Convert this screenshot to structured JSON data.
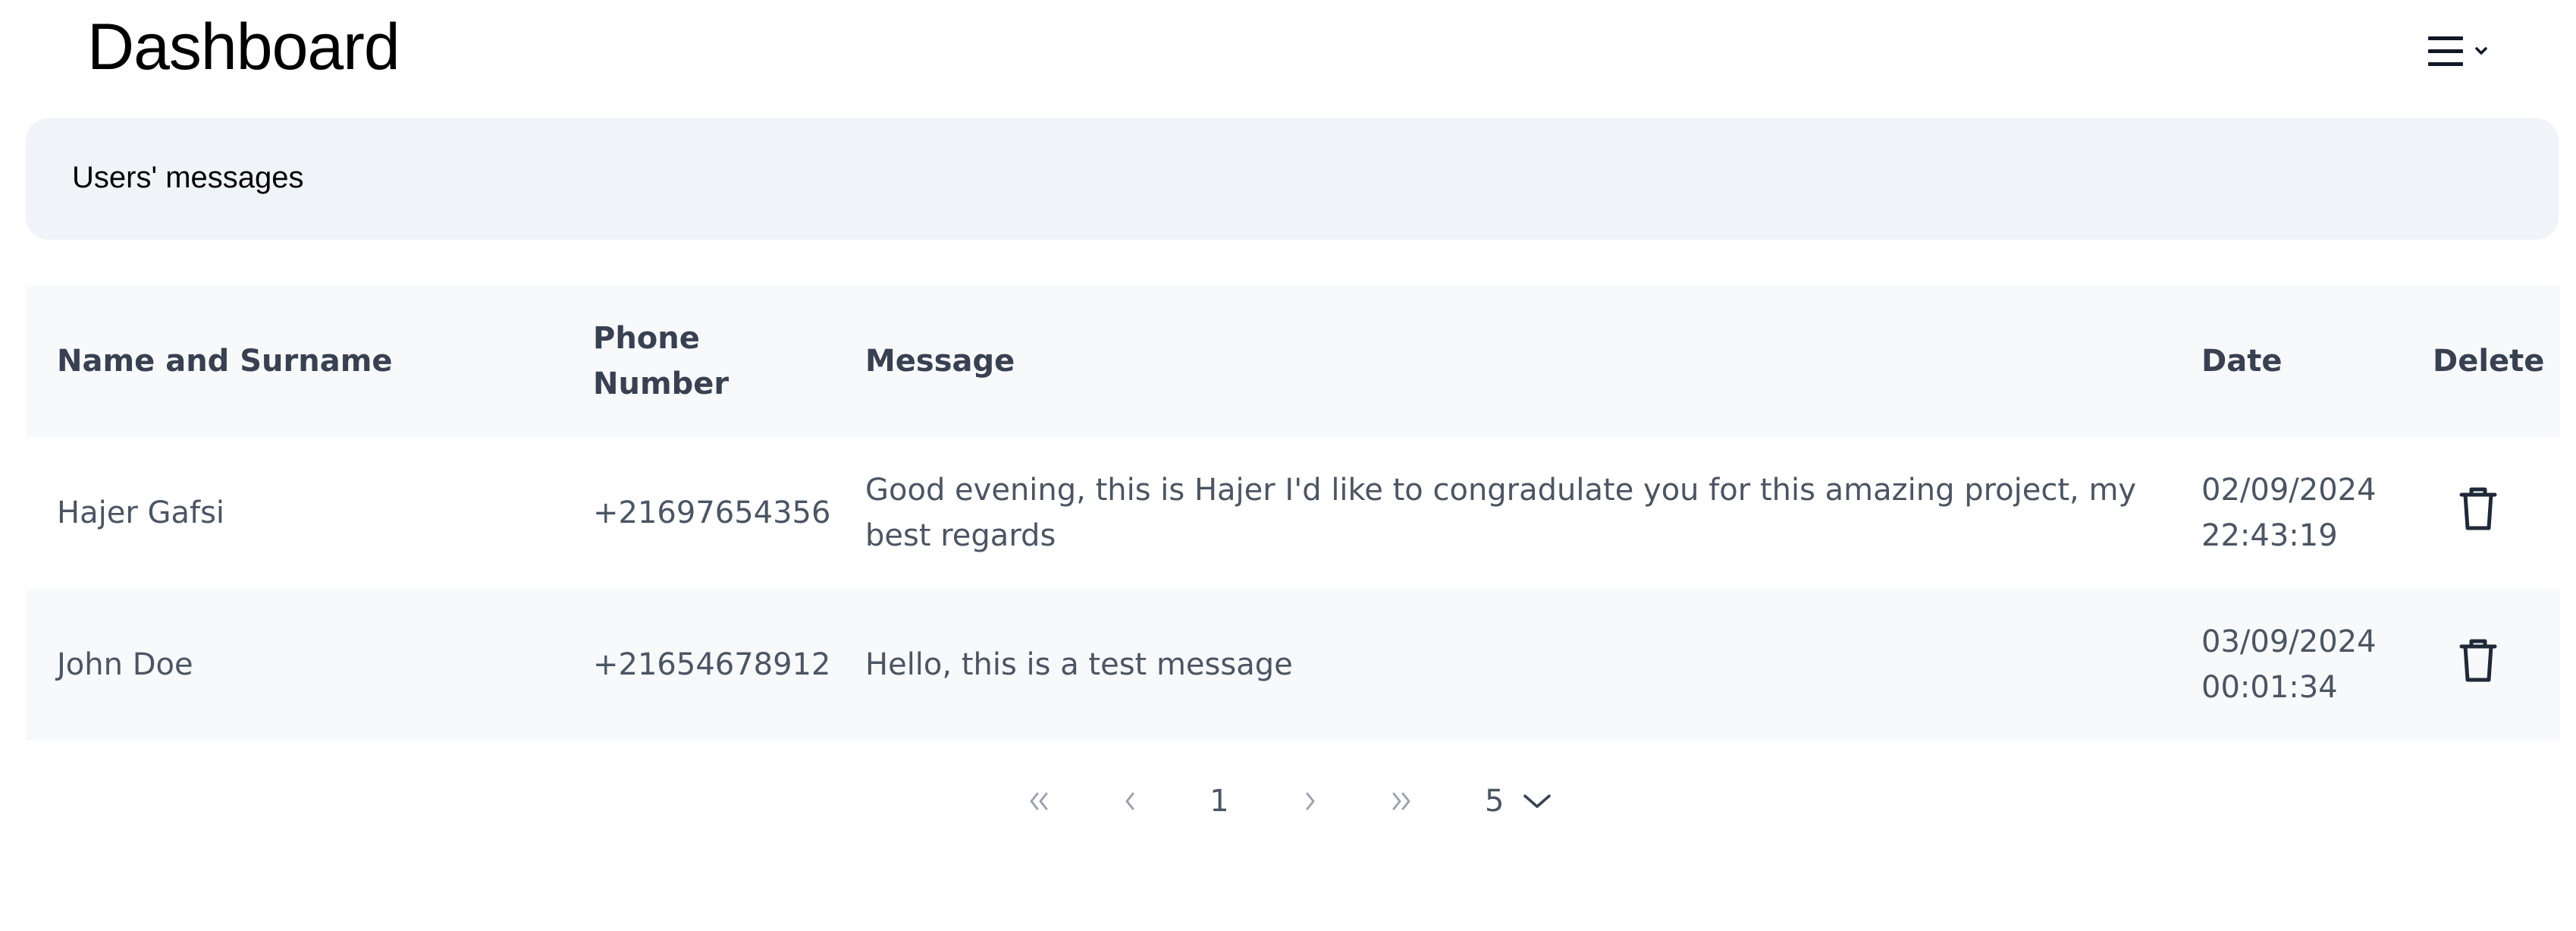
{
  "header": {
    "title": "Dashboard",
    "menu_icon": "hamburger-icon",
    "menu_chevron_icon": "chevron-down-icon"
  },
  "banner": {
    "text": "Users' messages"
  },
  "table": {
    "columns": [
      "Name and Surname",
      "Phone Number",
      "Message",
      "Date",
      "Delete"
    ],
    "rows": [
      {
        "name": "Hajer Gafsi",
        "phone": "+21697654356",
        "message": "Good evening, this is Hajer I'd like to congradulate you for this amazing project, my best regards",
        "date": "02/09/2024 22:43:19",
        "delete_icon": "trash-icon"
      },
      {
        "name": "John Doe",
        "phone": "+21654678912",
        "message": "Hello, this is a test message",
        "date": "03/09/2024 00:01:34",
        "delete_icon": "trash-icon"
      }
    ]
  },
  "pagination": {
    "first_icon": "double-chevron-left-icon",
    "prev_icon": "chevron-left-icon",
    "current_page": "1",
    "next_icon": "chevron-right-icon",
    "last_icon": "double-chevron-right-icon",
    "page_size": "5",
    "page_size_icon": "chevron-down-icon"
  },
  "colors": {
    "banner_bg": "#f0f3f8",
    "row_alt_bg": "#f8f9fb",
    "text": "#4b5563",
    "header_text": "#374151",
    "pager_muted": "#9ca3af"
  }
}
